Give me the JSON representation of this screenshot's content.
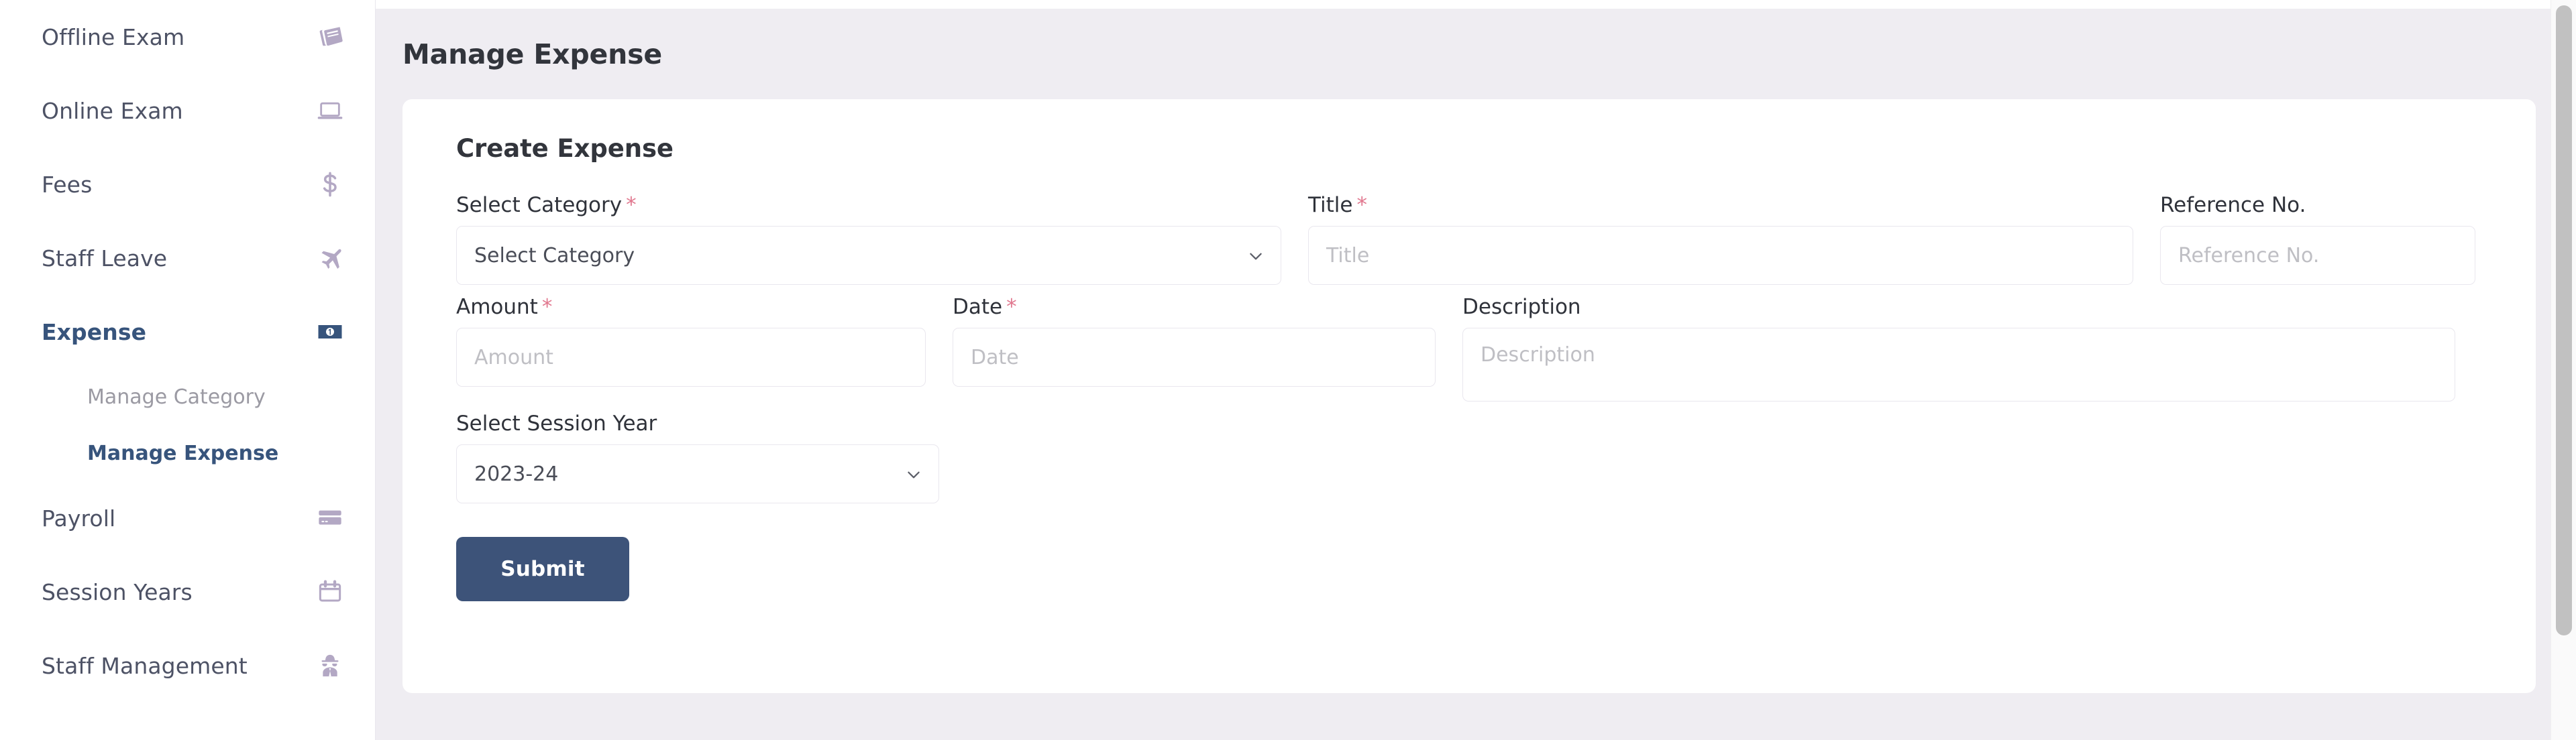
{
  "sidebar": {
    "items": [
      {
        "label": "Offline Exam",
        "icon": "book-icon",
        "active": false
      },
      {
        "label": "Online Exam",
        "icon": "laptop-icon",
        "active": false
      },
      {
        "label": "Fees",
        "icon": "dollar-icon",
        "active": false
      },
      {
        "label": "Staff Leave",
        "icon": "airplane-icon",
        "active": false
      },
      {
        "label": "Expense",
        "icon": "banknote-icon",
        "active": true
      },
      {
        "label": "Payroll",
        "icon": "credit-card-icon",
        "active": false
      },
      {
        "label": "Session Years",
        "icon": "calendar-icon",
        "active": false
      },
      {
        "label": "Staff Management",
        "icon": "spy-icon",
        "active": false
      }
    ],
    "sub_items": [
      {
        "label": "Manage Category",
        "active": false
      },
      {
        "label": "Manage Expense",
        "active": true
      }
    ]
  },
  "header": {
    "title": "Manage Expense"
  },
  "card": {
    "title": "Create Expense",
    "fields": {
      "category": {
        "label": "Select Category",
        "required": "*",
        "value": "Select Category",
        "chevron": "chevron-down-icon"
      },
      "title": {
        "label": "Title",
        "required": "*",
        "placeholder": "Title",
        "value": ""
      },
      "reference": {
        "label": "Reference No.",
        "required": "",
        "placeholder": "Reference No.",
        "value": ""
      },
      "amount": {
        "label": "Amount",
        "required": "*",
        "placeholder": "Amount",
        "value": ""
      },
      "date": {
        "label": "Date",
        "required": "*",
        "placeholder": "Date",
        "value": ""
      },
      "description": {
        "label": "Description",
        "required": "",
        "placeholder": "Description",
        "value": ""
      },
      "session_year": {
        "label": "Select Session Year",
        "required": "",
        "value": "2023-24",
        "chevron": "chevron-down-icon"
      }
    },
    "submit_label": "Submit"
  },
  "colors": {
    "accent": "#3d5379",
    "required_asterisk": "#e1788f",
    "sidebar_icon": "#b3a8c4",
    "page_background": "#efedf2",
    "card_background": "#ffffff"
  }
}
